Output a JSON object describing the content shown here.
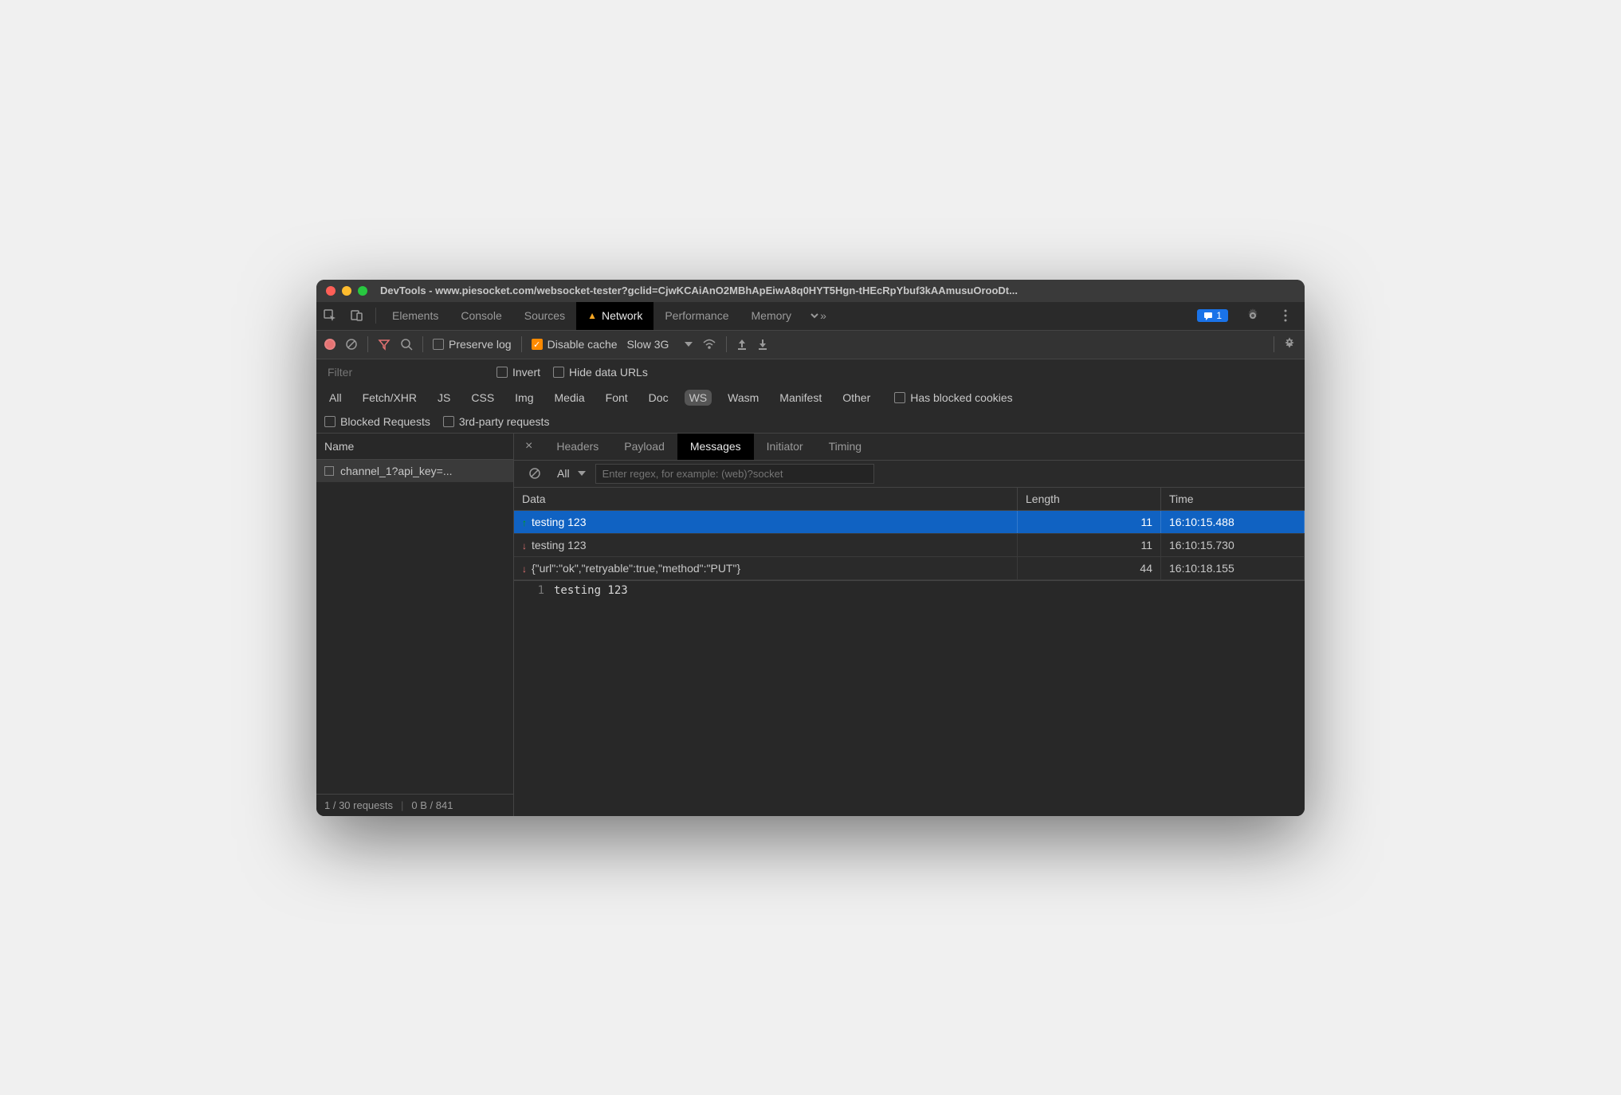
{
  "window": {
    "title": "DevTools - www.piesocket.com/websocket-tester?gclid=CjwKCAiAnO2MBhApEiwA8q0HYT5Hgn-tHEcRpYbuf3kAAmusuOrooDt..."
  },
  "main_tabs": {
    "items": [
      "Elements",
      "Console",
      "Sources",
      "Network",
      "Performance",
      "Memory"
    ],
    "active": 3,
    "issues_count": "1"
  },
  "toolbar": {
    "preserve_log": "Preserve log",
    "disable_cache": "Disable cache",
    "throttling": "Slow 3G"
  },
  "filter": {
    "placeholder": "Filter",
    "invert": "Invert",
    "hide_data_urls": "Hide data URLs",
    "types": [
      "All",
      "Fetch/XHR",
      "JS",
      "CSS",
      "Img",
      "Media",
      "Font",
      "Doc",
      "WS",
      "Wasm",
      "Manifest",
      "Other"
    ],
    "selected_type": 8,
    "has_blocked_cookies": "Has blocked cookies",
    "blocked_requests": "Blocked Requests",
    "third_party": "3rd-party requests"
  },
  "sidebar": {
    "header": "Name",
    "items": [
      {
        "name": "channel_1?api_key=..."
      }
    ],
    "footer": {
      "requests": "1 / 30 requests",
      "transfer": "0 B / 841"
    }
  },
  "detail_tabs": {
    "items": [
      "Headers",
      "Payload",
      "Messages",
      "Initiator",
      "Timing"
    ],
    "active": 2
  },
  "messages": {
    "filter_label": "All",
    "regex_placeholder": "Enter regex, for example: (web)?socket",
    "columns": {
      "data": "Data",
      "length": "Length",
      "time": "Time"
    },
    "rows": [
      {
        "dir": "up",
        "data": "testing 123",
        "length": "11",
        "time": "16:10:15.488",
        "selected": true
      },
      {
        "dir": "down",
        "data": "testing 123",
        "length": "11",
        "time": "16:10:15.730",
        "selected": false
      },
      {
        "dir": "down",
        "data": "{\"url\":\"ok\",\"retryable\":true,\"method\":\"PUT\"}",
        "length": "44",
        "time": "16:10:18.155",
        "selected": false
      }
    ]
  },
  "preview": {
    "line_number": "1",
    "text": "testing 123"
  }
}
